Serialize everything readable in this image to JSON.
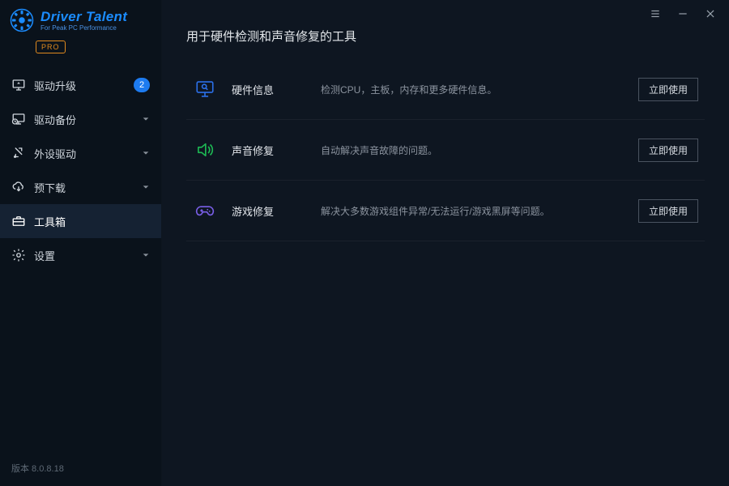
{
  "app": {
    "name": "Driver Talent",
    "tagline": "For Peak PC Performance",
    "pro_badge": "PRO",
    "version_label": "版本 8.0.8.18"
  },
  "sidebar": {
    "items": [
      {
        "key": "upgrade",
        "label": "驱动升级",
        "badge": "2",
        "chev": false
      },
      {
        "key": "backup",
        "label": "驱动备份",
        "badge": null,
        "chev": true
      },
      {
        "key": "peripheral",
        "label": "外设驱动",
        "badge": null,
        "chev": true
      },
      {
        "key": "predl",
        "label": "预下载",
        "badge": null,
        "chev": true
      },
      {
        "key": "toolbox",
        "label": "工具箱",
        "badge": null,
        "chev": false,
        "active": true
      },
      {
        "key": "settings",
        "label": "设置",
        "badge": null,
        "chev": true
      }
    ]
  },
  "main": {
    "title": "用于硬件检测和声音修复的工具",
    "tools": [
      {
        "key": "hwinfo",
        "name": "硬件信息",
        "desc": "检测CPU，主板，内存和更多硬件信息。",
        "btn": "立即使用"
      },
      {
        "key": "sound",
        "name": "声音修复",
        "desc": "自动解决声音故障的问题。",
        "btn": "立即使用"
      },
      {
        "key": "game",
        "name": "游戏修复",
        "desc": "解决大多数游戏组件异常/无法运行/游戏黑屏等问题。",
        "btn": "立即使用"
      }
    ]
  }
}
